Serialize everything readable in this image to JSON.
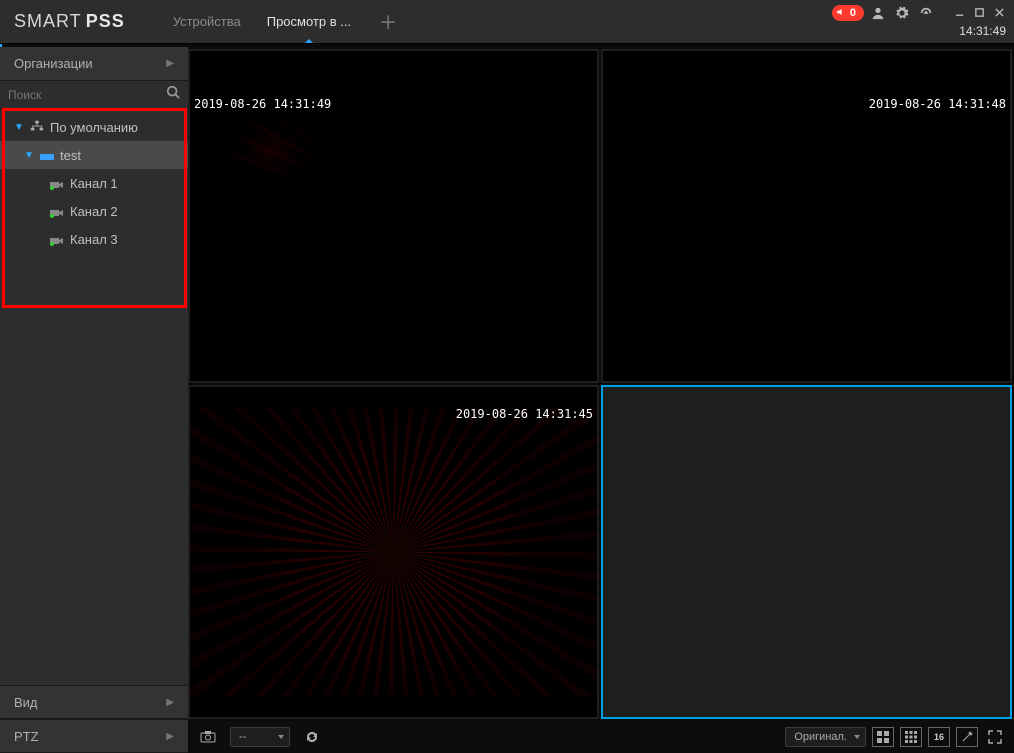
{
  "app": {
    "logo_a": "SMART",
    "logo_b": "PSS"
  },
  "tabs": {
    "devices": "Устройства",
    "live": "Просмотр в ..."
  },
  "header": {
    "badge_count": "0",
    "clock": "14:31:49"
  },
  "sidebar": {
    "section_org": "Организации",
    "search_placeholder": "Поиск",
    "tree": {
      "root_label": "По умолчанию",
      "device_label": "test",
      "channels": [
        "Канал 1",
        "Канал 2",
        "Канал 3"
      ]
    },
    "section_view": "Вид",
    "section_ptz": "PTZ"
  },
  "video": {
    "ts1": "2019-08-26 14:31:49",
    "ts2": "2019-08-26 14:31:48",
    "ts3": "2019-08-26 14:31:45"
  },
  "bottombar": {
    "select1": "--",
    "aspect_label": "Оригинал.",
    "grid_num": "16"
  }
}
